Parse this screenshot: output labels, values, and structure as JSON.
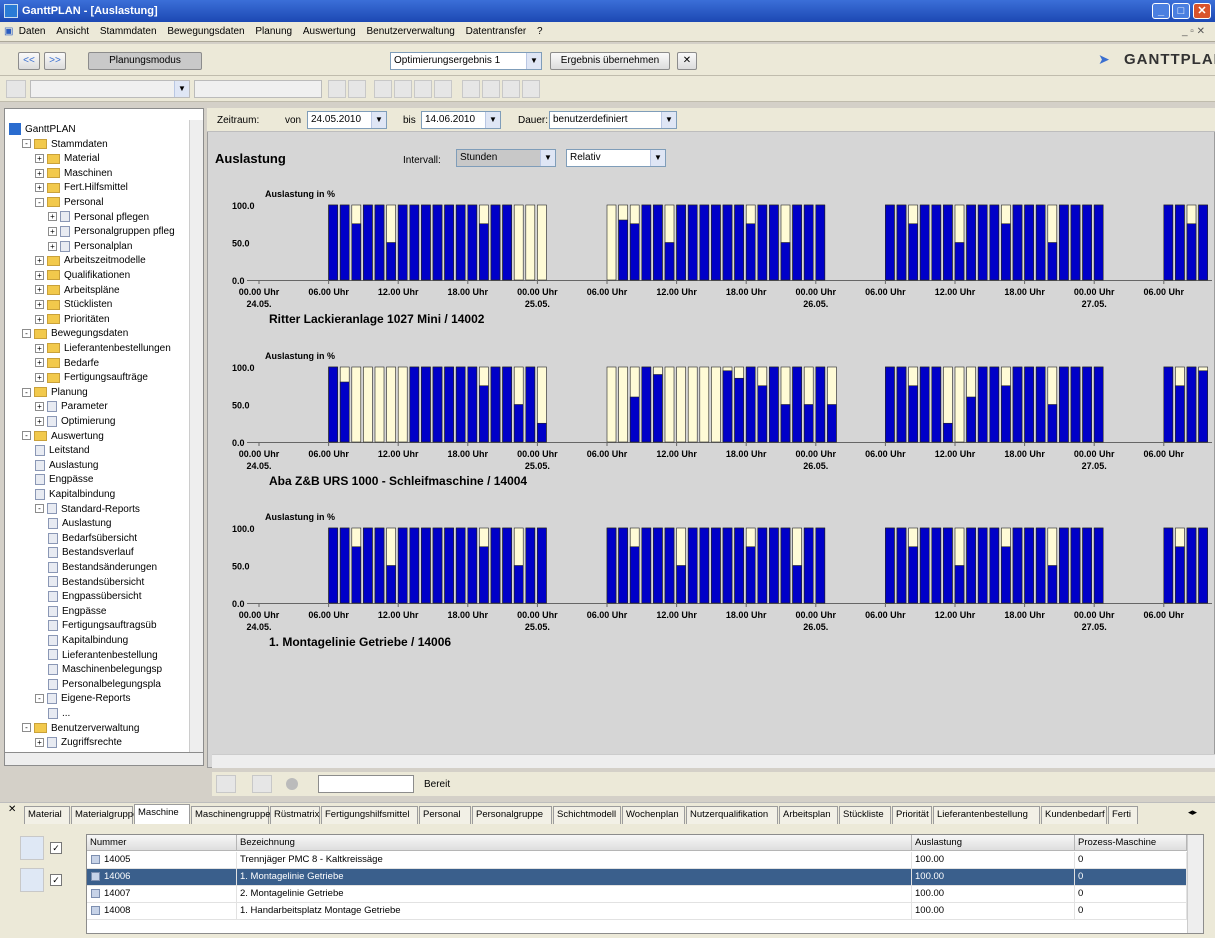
{
  "window": {
    "title": "GanttPLAN - [Auslastung]"
  },
  "menu": [
    "Daten",
    "Ansicht",
    "Stammdaten",
    "Bewegungsdaten",
    "Planung",
    "Auswertung",
    "Benutzerverwaltung",
    "Datentransfer",
    "?"
  ],
  "toolbar": {
    "back_label": "<<",
    "forward_label": ">>",
    "mode_label": "Planungsmodus",
    "result_combo": "Optimierungsergebnis 1",
    "apply_label": "Ergebnis übernehmen",
    "logo": "GANTTPLAN"
  },
  "filter": {
    "zeitraum_label": "Zeitraum:",
    "von_label": "von",
    "von_value": "24.05.2010",
    "bis_label": "bis",
    "bis_value": "14.06.2010",
    "dauer_label": "Dauer:",
    "dauer_value": "benutzerdefiniert"
  },
  "page": {
    "title": "Auslastung",
    "intervall_label": "Intervall:",
    "intervall_value": "Stunden",
    "mode_value": "Relativ"
  },
  "tree": [
    {
      "label": "GanttPLAN",
      "level": 0,
      "kind": "root"
    },
    {
      "label": "Stammdaten",
      "level": 1,
      "kind": "folder",
      "exp": "-"
    },
    {
      "label": "Material",
      "level": 2,
      "kind": "folder",
      "exp": "+"
    },
    {
      "label": "Maschinen",
      "level": 2,
      "kind": "folder",
      "exp": "+"
    },
    {
      "label": "Fert.Hilfsmittel",
      "level": 2,
      "kind": "folder",
      "exp": "+"
    },
    {
      "label": "Personal",
      "level": 2,
      "kind": "folder",
      "exp": "-"
    },
    {
      "label": "Personal pflegen",
      "level": 3,
      "kind": "doc",
      "exp": "+"
    },
    {
      "label": "Personalgruppen pfleg",
      "level": 3,
      "kind": "doc",
      "exp": "+"
    },
    {
      "label": "Personalplan",
      "level": 3,
      "kind": "doc",
      "exp": "+"
    },
    {
      "label": "Arbeitszeitmodelle",
      "level": 2,
      "kind": "folder",
      "exp": "+"
    },
    {
      "label": "Qualifikationen",
      "level": 2,
      "kind": "folder",
      "exp": "+"
    },
    {
      "label": "Arbeitspläne",
      "level": 2,
      "kind": "folder",
      "exp": "+"
    },
    {
      "label": "Stücklisten",
      "level": 2,
      "kind": "folder",
      "exp": "+"
    },
    {
      "label": "Prioritäten",
      "level": 2,
      "kind": "folder",
      "exp": "+"
    },
    {
      "label": "Bewegungsdaten",
      "level": 1,
      "kind": "folder",
      "exp": "-"
    },
    {
      "label": "Lieferantenbestellungen",
      "level": 2,
      "kind": "folder",
      "exp": "+"
    },
    {
      "label": "Bedarfe",
      "level": 2,
      "kind": "folder",
      "exp": "+"
    },
    {
      "label": "Fertigungsaufträge",
      "level": 2,
      "kind": "folder",
      "exp": "+"
    },
    {
      "label": "Planung",
      "level": 1,
      "kind": "folder",
      "exp": "-"
    },
    {
      "label": "Parameter",
      "level": 2,
      "kind": "doc",
      "exp": "+"
    },
    {
      "label": "Optimierung",
      "level": 2,
      "kind": "doc",
      "exp": "+"
    },
    {
      "label": "Auswertung",
      "level": 1,
      "kind": "folder",
      "exp": "-"
    },
    {
      "label": "Leitstand",
      "level": 2,
      "kind": "doc",
      "exp": ""
    },
    {
      "label": "Auslastung",
      "level": 2,
      "kind": "doc",
      "exp": ""
    },
    {
      "label": "Engpässe",
      "level": 2,
      "kind": "doc",
      "exp": ""
    },
    {
      "label": "Kapitalbindung",
      "level": 2,
      "kind": "doc",
      "exp": ""
    },
    {
      "label": "Standard-Reports",
      "level": 2,
      "kind": "doc",
      "exp": "-"
    },
    {
      "label": "Auslastung",
      "level": 3,
      "kind": "doc",
      "exp": ""
    },
    {
      "label": "Bedarfsübersicht",
      "level": 3,
      "kind": "doc",
      "exp": ""
    },
    {
      "label": "Bestandsverlauf",
      "level": 3,
      "kind": "doc",
      "exp": ""
    },
    {
      "label": "Bestandsänderungen",
      "level": 3,
      "kind": "doc",
      "exp": ""
    },
    {
      "label": "Bestandsübersicht",
      "level": 3,
      "kind": "doc",
      "exp": ""
    },
    {
      "label": "Engpassübersicht",
      "level": 3,
      "kind": "doc",
      "exp": ""
    },
    {
      "label": "Engpässe",
      "level": 3,
      "kind": "doc",
      "exp": ""
    },
    {
      "label": "Fertigungsauftragsüb",
      "level": 3,
      "kind": "doc",
      "exp": ""
    },
    {
      "label": "Kapitalbindung",
      "level": 3,
      "kind": "doc",
      "exp": ""
    },
    {
      "label": "Lieferantenbestellung",
      "level": 3,
      "kind": "doc",
      "exp": ""
    },
    {
      "label": "Maschinenbelegungsp",
      "level": 3,
      "kind": "doc",
      "exp": ""
    },
    {
      "label": "Personalbelegungspla",
      "level": 3,
      "kind": "doc",
      "exp": ""
    },
    {
      "label": "Eigene-Reports",
      "level": 2,
      "kind": "doc",
      "exp": "-"
    },
    {
      "label": "...",
      "level": 3,
      "kind": "doc",
      "exp": ""
    },
    {
      "label": "Benutzerverwaltung",
      "level": 1,
      "kind": "folder",
      "exp": "-"
    },
    {
      "label": "Zugriffsrechte",
      "level": 2,
      "kind": "doc",
      "exp": "+"
    }
  ],
  "status": {
    "text": "Bereit"
  },
  "tabs": [
    "Material",
    "Materialgruppe",
    "Maschine",
    "Maschinengruppe",
    "Rüstmatrix",
    "Fertigungshilfsmittel",
    "Personal",
    "Personalgruppe",
    "Schichtmodell",
    "Wochenplan",
    "Nutzerqualifikation",
    "Arbeitsplan",
    "Stückliste",
    "Priorität",
    "Lieferantenbestellung",
    "Kundenbedarf",
    "Ferti"
  ],
  "active_tab": "Maschine",
  "grid": {
    "columns": [
      "Nummer",
      "Bezeichnung",
      "Auslastung",
      "Prozess-Maschine"
    ],
    "rows": [
      [
        "14005",
        "Trennjäger PMC 8 - Kaltkreissäge",
        "100.00",
        "0"
      ],
      [
        "14006",
        "1. Montagelinie Getriebe",
        "100.00",
        "0"
      ],
      [
        "14007",
        "2. Montagelinie Getriebe",
        "100.00",
        "0"
      ],
      [
        "14008",
        "1. Handarbeitsplatz Montage Getriebe",
        "100.00",
        "0"
      ]
    ],
    "selected_row": 1
  },
  "colors": {
    "bar_used": "#0000c8",
    "bar_free": "#fffbd6",
    "chart_bg": "#d6d6d6"
  },
  "chart_data": [
    {
      "type": "bar",
      "stacked": true,
      "ylabel": "Auslastung in %",
      "yticks": [
        "0.0",
        "50.0",
        "100.0"
      ],
      "ylim": [
        0,
        100
      ],
      "xticks": [
        "00.00 Uhr",
        "06.00 Uhr",
        "12.00 Uhr",
        "18.00 Uhr",
        "00.00 Uhr",
        "06.00 Uhr",
        "12.00 Uhr",
        "18.00 Uhr",
        "00.00 Uhr",
        "06.00 Uhr",
        "12.00 Uhr",
        "18.00 Uhr",
        "00.00 Uhr",
        "06.00 Uhr"
      ],
      "dates": [
        "24.05.",
        "25.05.",
        "26.05.",
        "27.05."
      ],
      "title": "Ritter Lackieranlage 1027 Mini / 14002",
      "blocks": [
        {
          "start": 6,
          "values": [
            100,
            100,
            75,
            100,
            100,
            50,
            100,
            100,
            100,
            100,
            100,
            100,
            100,
            75,
            100,
            100,
            0,
            0,
            0
          ]
        },
        {
          "start": 30,
          "values": [
            0,
            80,
            75,
            100,
            100,
            50,
            100,
            100,
            100,
            100,
            100,
            100,
            75,
            100,
            100,
            50,
            100,
            100,
            100
          ]
        },
        {
          "start": 54,
          "values": [
            100,
            100,
            75,
            100,
            100,
            100,
            50,
            100,
            100,
            100,
            75,
            100,
            100,
            100,
            50,
            100,
            100,
            100,
            100
          ]
        },
        {
          "start": 78,
          "values": [
            100,
            100,
            75,
            100
          ]
        }
      ]
    },
    {
      "type": "bar",
      "stacked": true,
      "ylabel": "Auslastung in %",
      "yticks": [
        "0.0",
        "50.0",
        "100.0"
      ],
      "ylim": [
        0,
        100
      ],
      "xticks": [
        "00.00 Uhr",
        "06.00 Uhr",
        "12.00 Uhr",
        "18.00 Uhr",
        "00.00 Uhr",
        "06.00 Uhr",
        "12.00 Uhr",
        "18.00 Uhr",
        "00.00 Uhr",
        "06.00 Uhr",
        "12.00 Uhr",
        "18.00 Uhr",
        "00.00 Uhr",
        "06.00 Uhr"
      ],
      "dates": [
        "24.05.",
        "25.05.",
        "26.05.",
        "27.05."
      ],
      "title": "Aba Z&B URS 1000 - Schleifmaschine / 14004",
      "blocks": [
        {
          "start": 6,
          "values": [
            100,
            80,
            0,
            0,
            0,
            0,
            0,
            100,
            100,
            100,
            100,
            100,
            100,
            75,
            100,
            100,
            50,
            100,
            25
          ]
        },
        {
          "start": 30,
          "values": [
            0,
            0,
            60,
            100,
            90,
            0,
            0,
            0,
            0,
            0,
            95,
            85,
            100,
            75,
            100,
            50,
            100,
            50,
            100,
            50
          ]
        },
        {
          "start": 54,
          "values": [
            100,
            100,
            75,
            100,
            100,
            25,
            0,
            60,
            100,
            100,
            75,
            100,
            100,
            100,
            50,
            100,
            100,
            100,
            100
          ]
        },
        {
          "start": 78,
          "values": [
            100,
            75,
            100,
            95
          ]
        }
      ]
    },
    {
      "type": "bar",
      "stacked": true,
      "ylabel": "Auslastung in %",
      "yticks": [
        "0.0",
        "50.0",
        "100.0"
      ],
      "ylim": [
        0,
        100
      ],
      "xticks": [
        "00.00 Uhr",
        "06.00 Uhr",
        "12.00 Uhr",
        "18.00 Uhr",
        "00.00 Uhr",
        "06.00 Uhr",
        "12.00 Uhr",
        "18.00 Uhr",
        "00.00 Uhr",
        "06.00 Uhr",
        "12.00 Uhr",
        "18.00 Uhr",
        "00.00 Uhr",
        "06.00 Uhr"
      ],
      "dates": [
        "24.05.",
        "25.05.",
        "26.05.",
        "27.05."
      ],
      "title": "1. Montagelinie Getriebe / 14006",
      "blocks": [
        {
          "start": 6,
          "values": [
            100,
            100,
            75,
            100,
            100,
            50,
            100,
            100,
            100,
            100,
            100,
            100,
            100,
            75,
            100,
            100,
            50,
            100,
            100
          ]
        },
        {
          "start": 30,
          "values": [
            100,
            100,
            75,
            100,
            100,
            100,
            50,
            100,
            100,
            100,
            100,
            100,
            75,
            100,
            100,
            100,
            50,
            100,
            100
          ]
        },
        {
          "start": 54,
          "values": [
            100,
            100,
            75,
            100,
            100,
            100,
            50,
            100,
            100,
            100,
            75,
            100,
            100,
            100,
            50,
            100,
            100,
            100,
            100
          ]
        },
        {
          "start": 78,
          "values": [
            100,
            75,
            100,
            100
          ]
        }
      ]
    }
  ]
}
